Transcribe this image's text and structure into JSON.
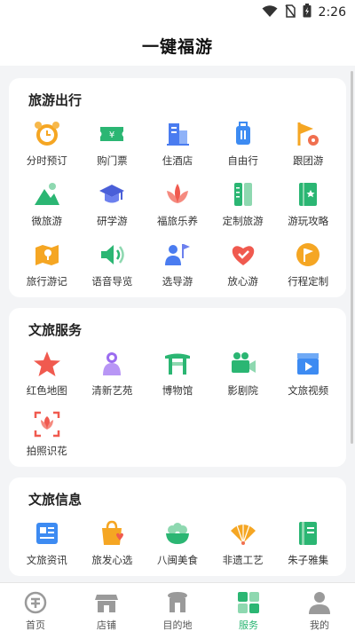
{
  "status": {
    "time": "2:26"
  },
  "header": {
    "title": "一键福游"
  },
  "sections": [
    {
      "title": "旅游出行",
      "items": [
        {
          "label": "分时预订",
          "icon": "alarm-clock-icon"
        },
        {
          "label": "购门票",
          "icon": "ticket-icon"
        },
        {
          "label": "住酒店",
          "icon": "hotel-building-icon"
        },
        {
          "label": "自由行",
          "icon": "suitcase-icon"
        },
        {
          "label": "跟团游",
          "icon": "flag-location-icon"
        },
        {
          "label": "微旅游",
          "icon": "mountain-icon"
        },
        {
          "label": "研学游",
          "icon": "graduation-cap-icon"
        },
        {
          "label": "福旅乐养",
          "icon": "lotus-icon"
        },
        {
          "label": "定制旅游",
          "icon": "ruler-notebook-icon"
        },
        {
          "label": "游玩攻略",
          "icon": "guide-book-icon"
        },
        {
          "label": "旅行游记",
          "icon": "map-pin-icon"
        },
        {
          "label": "语音导览",
          "icon": "speaker-icon"
        },
        {
          "label": "选导游",
          "icon": "guide-person-icon"
        },
        {
          "label": "放心游",
          "icon": "heart-icon"
        },
        {
          "label": "行程定制",
          "icon": "flag-circle-icon"
        }
      ]
    },
    {
      "title": "文旅服务",
      "items": [
        {
          "label": "红色地图",
          "icon": "red-star-icon"
        },
        {
          "label": "清新艺苑",
          "icon": "art-figure-icon"
        },
        {
          "label": "博物馆",
          "icon": "museum-gate-icon"
        },
        {
          "label": "影剧院",
          "icon": "video-camera-icon"
        },
        {
          "label": "文旅视频",
          "icon": "clapperboard-icon"
        },
        {
          "label": "拍照识花",
          "icon": "flower-scan-icon"
        }
      ]
    },
    {
      "title": "文旅信息",
      "items": [
        {
          "label": "文旅资讯",
          "icon": "news-icon"
        },
        {
          "label": "旅发心选",
          "icon": "shopping-bag-icon"
        },
        {
          "label": "八闽美食",
          "icon": "food-bowl-icon"
        },
        {
          "label": "非遗工艺",
          "icon": "folding-fan-icon"
        },
        {
          "label": "朱子雅集",
          "icon": "book-icon"
        }
      ]
    }
  ],
  "tabbar": [
    {
      "label": "首页",
      "icon": "home-fu-icon"
    },
    {
      "label": "店铺",
      "icon": "shop-icon"
    },
    {
      "label": "目的地",
      "icon": "destination-icon"
    },
    {
      "label": "服务",
      "icon": "services-grid-icon",
      "active": true
    },
    {
      "label": "我的",
      "icon": "user-icon"
    }
  ],
  "colors": {
    "accent": "#2bb673",
    "orange": "#f5a623",
    "blue": "#3d8bf2",
    "red": "#f05a4f"
  }
}
